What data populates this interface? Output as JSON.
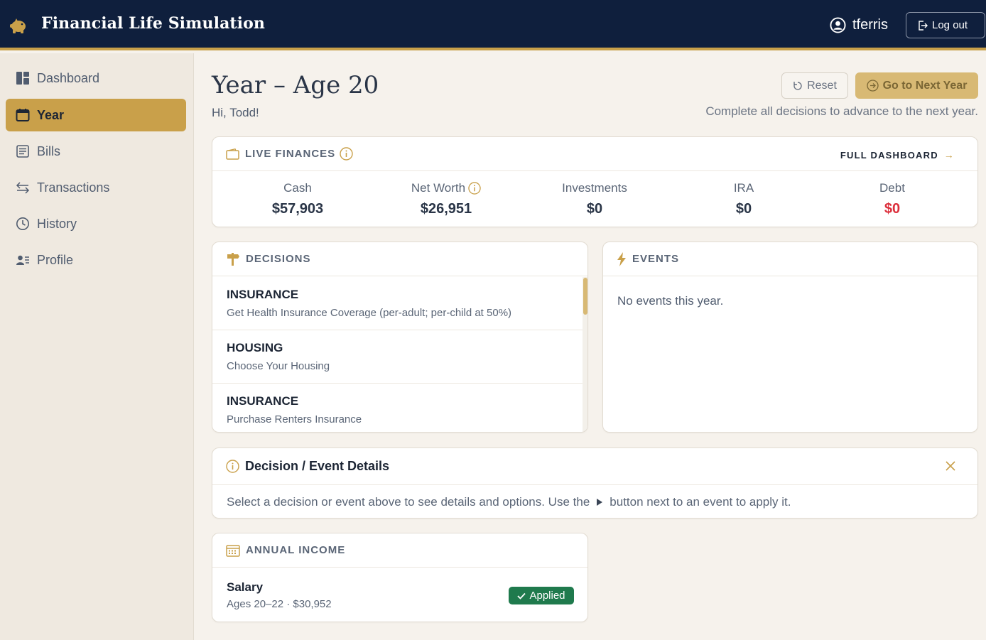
{
  "app": {
    "title": "Financial Life Simulation",
    "username": "tferris",
    "logout_label": "Log out"
  },
  "sidebar": {
    "items": [
      {
        "label": "Dashboard",
        "icon": "dashboard-icon",
        "active": false
      },
      {
        "label": "Year",
        "icon": "calendar-icon",
        "active": true
      },
      {
        "label": "Bills",
        "icon": "bills-icon",
        "active": false
      },
      {
        "label": "Transactions",
        "icon": "transfer-icon",
        "active": false
      },
      {
        "label": "History",
        "icon": "clock-icon",
        "active": false
      },
      {
        "label": "Profile",
        "icon": "profile-icon",
        "active": false
      }
    ]
  },
  "header": {
    "title": "Year – Age 20",
    "greeting": "Hi, Todd!",
    "reset_label": "Reset",
    "next_label": "Go to Next Year",
    "advance_note": "Complete all decisions to advance to the next year."
  },
  "finances": {
    "heading": "LIVE FINANCES",
    "full_dashboard_label": "FULL DASHBOARD",
    "metrics": [
      {
        "label": "Cash",
        "value": "$57,903"
      },
      {
        "label": "Net Worth",
        "value": "$26,951"
      },
      {
        "label": "Investments",
        "value": "$0"
      },
      {
        "label": "IRA",
        "value": "$0"
      },
      {
        "label": "Debt",
        "value": "$0"
      }
    ]
  },
  "decisions": {
    "heading": "DECISIONS",
    "items": [
      {
        "category": "INSURANCE",
        "description": "Get Health Insurance Coverage (per-adult; per-child at 50%)"
      },
      {
        "category": "HOUSING",
        "description": "Choose Your Housing"
      },
      {
        "category": "INSURANCE",
        "description": "Purchase Renters Insurance"
      }
    ]
  },
  "events": {
    "heading": "EVENTS",
    "empty_text": "No events this year."
  },
  "details": {
    "heading": "Decision / Event Details",
    "text_before": "Select a decision or event above to see details and options. Use the",
    "text_after": "button next to an event to apply it."
  },
  "income": {
    "heading": "ANNUAL INCOME",
    "items": [
      {
        "name": "Salary",
        "sub": "Ages 20–22 · $30,952",
        "status": "Applied"
      }
    ]
  },
  "colors": {
    "navy": "#0f1f3d",
    "gold": "#c9a04a",
    "debt_red": "#dc2f3c",
    "applied_green": "#1f7a4d"
  }
}
